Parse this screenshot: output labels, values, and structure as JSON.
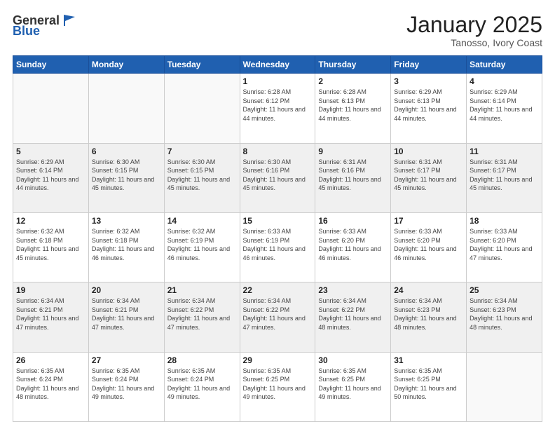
{
  "header": {
    "logo_general": "General",
    "logo_blue": "Blue",
    "title": "January 2025",
    "location": "Tanosso, Ivory Coast"
  },
  "days_of_week": [
    "Sunday",
    "Monday",
    "Tuesday",
    "Wednesday",
    "Thursday",
    "Friday",
    "Saturday"
  ],
  "weeks": [
    [
      {
        "day": "",
        "info": ""
      },
      {
        "day": "",
        "info": ""
      },
      {
        "day": "",
        "info": ""
      },
      {
        "day": "1",
        "info": "Sunrise: 6:28 AM\nSunset: 6:12 PM\nDaylight: 11 hours and 44 minutes."
      },
      {
        "day": "2",
        "info": "Sunrise: 6:28 AM\nSunset: 6:13 PM\nDaylight: 11 hours and 44 minutes."
      },
      {
        "day": "3",
        "info": "Sunrise: 6:29 AM\nSunset: 6:13 PM\nDaylight: 11 hours and 44 minutes."
      },
      {
        "day": "4",
        "info": "Sunrise: 6:29 AM\nSunset: 6:14 PM\nDaylight: 11 hours and 44 minutes."
      }
    ],
    [
      {
        "day": "5",
        "info": "Sunrise: 6:29 AM\nSunset: 6:14 PM\nDaylight: 11 hours and 44 minutes."
      },
      {
        "day": "6",
        "info": "Sunrise: 6:30 AM\nSunset: 6:15 PM\nDaylight: 11 hours and 45 minutes."
      },
      {
        "day": "7",
        "info": "Sunrise: 6:30 AM\nSunset: 6:15 PM\nDaylight: 11 hours and 45 minutes."
      },
      {
        "day": "8",
        "info": "Sunrise: 6:30 AM\nSunset: 6:16 PM\nDaylight: 11 hours and 45 minutes."
      },
      {
        "day": "9",
        "info": "Sunrise: 6:31 AM\nSunset: 6:16 PM\nDaylight: 11 hours and 45 minutes."
      },
      {
        "day": "10",
        "info": "Sunrise: 6:31 AM\nSunset: 6:17 PM\nDaylight: 11 hours and 45 minutes."
      },
      {
        "day": "11",
        "info": "Sunrise: 6:31 AM\nSunset: 6:17 PM\nDaylight: 11 hours and 45 minutes."
      }
    ],
    [
      {
        "day": "12",
        "info": "Sunrise: 6:32 AM\nSunset: 6:18 PM\nDaylight: 11 hours and 45 minutes."
      },
      {
        "day": "13",
        "info": "Sunrise: 6:32 AM\nSunset: 6:18 PM\nDaylight: 11 hours and 46 minutes."
      },
      {
        "day": "14",
        "info": "Sunrise: 6:32 AM\nSunset: 6:19 PM\nDaylight: 11 hours and 46 minutes."
      },
      {
        "day": "15",
        "info": "Sunrise: 6:33 AM\nSunset: 6:19 PM\nDaylight: 11 hours and 46 minutes."
      },
      {
        "day": "16",
        "info": "Sunrise: 6:33 AM\nSunset: 6:20 PM\nDaylight: 11 hours and 46 minutes."
      },
      {
        "day": "17",
        "info": "Sunrise: 6:33 AM\nSunset: 6:20 PM\nDaylight: 11 hours and 46 minutes."
      },
      {
        "day": "18",
        "info": "Sunrise: 6:33 AM\nSunset: 6:20 PM\nDaylight: 11 hours and 47 minutes."
      }
    ],
    [
      {
        "day": "19",
        "info": "Sunrise: 6:34 AM\nSunset: 6:21 PM\nDaylight: 11 hours and 47 minutes."
      },
      {
        "day": "20",
        "info": "Sunrise: 6:34 AM\nSunset: 6:21 PM\nDaylight: 11 hours and 47 minutes."
      },
      {
        "day": "21",
        "info": "Sunrise: 6:34 AM\nSunset: 6:22 PM\nDaylight: 11 hours and 47 minutes."
      },
      {
        "day": "22",
        "info": "Sunrise: 6:34 AM\nSunset: 6:22 PM\nDaylight: 11 hours and 47 minutes."
      },
      {
        "day": "23",
        "info": "Sunrise: 6:34 AM\nSunset: 6:22 PM\nDaylight: 11 hours and 48 minutes."
      },
      {
        "day": "24",
        "info": "Sunrise: 6:34 AM\nSunset: 6:23 PM\nDaylight: 11 hours and 48 minutes."
      },
      {
        "day": "25",
        "info": "Sunrise: 6:34 AM\nSunset: 6:23 PM\nDaylight: 11 hours and 48 minutes."
      }
    ],
    [
      {
        "day": "26",
        "info": "Sunrise: 6:35 AM\nSunset: 6:24 PM\nDaylight: 11 hours and 48 minutes."
      },
      {
        "day": "27",
        "info": "Sunrise: 6:35 AM\nSunset: 6:24 PM\nDaylight: 11 hours and 49 minutes."
      },
      {
        "day": "28",
        "info": "Sunrise: 6:35 AM\nSunset: 6:24 PM\nDaylight: 11 hours and 49 minutes."
      },
      {
        "day": "29",
        "info": "Sunrise: 6:35 AM\nSunset: 6:25 PM\nDaylight: 11 hours and 49 minutes."
      },
      {
        "day": "30",
        "info": "Sunrise: 6:35 AM\nSunset: 6:25 PM\nDaylight: 11 hours and 49 minutes."
      },
      {
        "day": "31",
        "info": "Sunrise: 6:35 AM\nSunset: 6:25 PM\nDaylight: 11 hours and 50 minutes."
      },
      {
        "day": "",
        "info": ""
      }
    ]
  ]
}
